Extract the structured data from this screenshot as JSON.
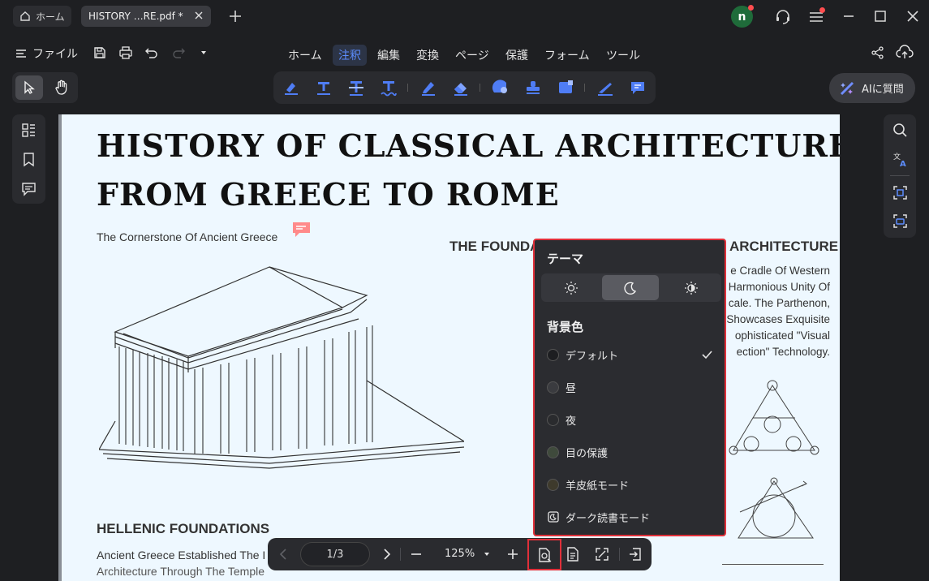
{
  "tabs": {
    "home_label": "ホーム",
    "doc_label": "HISTORY …RE.pdf *"
  },
  "user": {
    "avatar_initial": "n"
  },
  "menu": {
    "file_label": "ファイル",
    "items": [
      "ホーム",
      "注釈",
      "編集",
      "変換",
      "ページ",
      "保護",
      "フォーム",
      "ツール"
    ],
    "active": "注釈"
  },
  "ai": {
    "label": "AIに質問"
  },
  "document": {
    "title_line1": "HISTORY OF CLASSICAL  ARCHITECTURE:",
    "title_line2": "FROM GREECE TO ROME",
    "subtitle": "The Cornerstone Of Ancient Greece",
    "section_heading": "THE FOUNDA",
    "section_heading_end": "ARCHITECTURE",
    "body_lines": [
      "e Cradle Of Western",
      "Harmonious Unity Of",
      "cale. The Parthenon,",
      "Showcases Exquisite",
      "ophisticated \"Visual",
      "ection\" Technology."
    ],
    "hellenic_heading": "HELLENIC FOUNDATIONS",
    "hellenic_text": "Ancient Greece Established The I",
    "hellenic_text2": "Architecture Through The Temple"
  },
  "theme_popup": {
    "theme_heading": "テーマ",
    "theme_options": [
      "light",
      "dark",
      "auto"
    ],
    "theme_selected": "dark",
    "bg_heading": "背景色",
    "bg_options": [
      {
        "label": "デフォルト",
        "color": "#1d1e21",
        "selected": true
      },
      {
        "label": "昼",
        "color": "#3a3b3f",
        "selected": false
      },
      {
        "label": "夜",
        "color": "#2a2b2e",
        "selected": false
      },
      {
        "label": "目の保護",
        "color": "#3f4a3c",
        "selected": false
      },
      {
        "label": "羊皮紙モード",
        "color": "#3e3a2c",
        "selected": false
      }
    ],
    "dark_reading_label": "ダーク読書モード"
  },
  "pager": {
    "page_display": "1/3",
    "zoom": "125%"
  },
  "colors": {
    "accent": "#5c8dff",
    "highlight_border": "#e0303a",
    "page_bg": "#eef8ff"
  }
}
